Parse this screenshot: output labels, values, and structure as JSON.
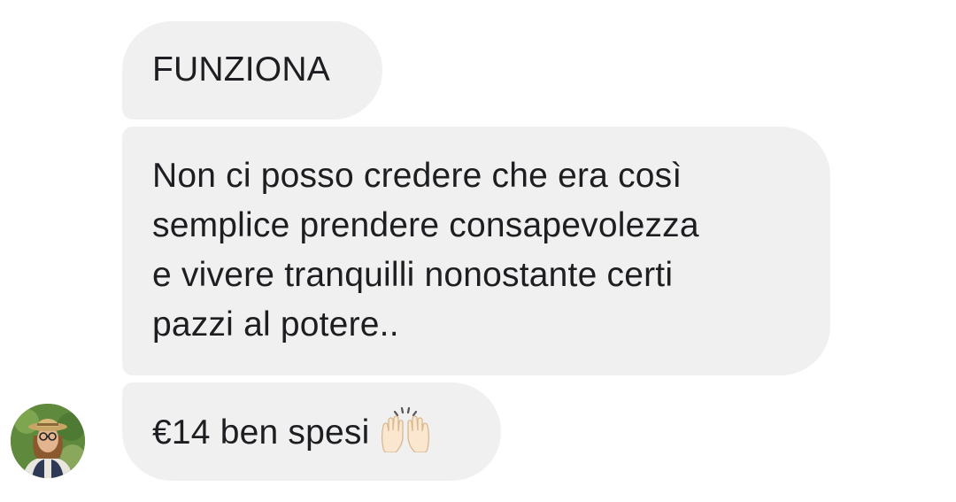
{
  "messages": [
    {
      "text": "FUNZIONA"
    },
    {
      "lines": [
        "Non ci posso credere che era così",
        "semplice prendere consapevolezza",
        "e vivere tranquilli nonostante certi",
        "pazzi al potere.."
      ]
    },
    {
      "text": "€14 ben spesi",
      "emoji": "raising-hands-icon"
    }
  ],
  "colors": {
    "bubble_background": "#f1f0f0",
    "text": "#1c1e21",
    "page_background": "#ffffff"
  },
  "icons": {
    "avatar": "sender-avatar",
    "emoji": "raising-hands-icon"
  }
}
